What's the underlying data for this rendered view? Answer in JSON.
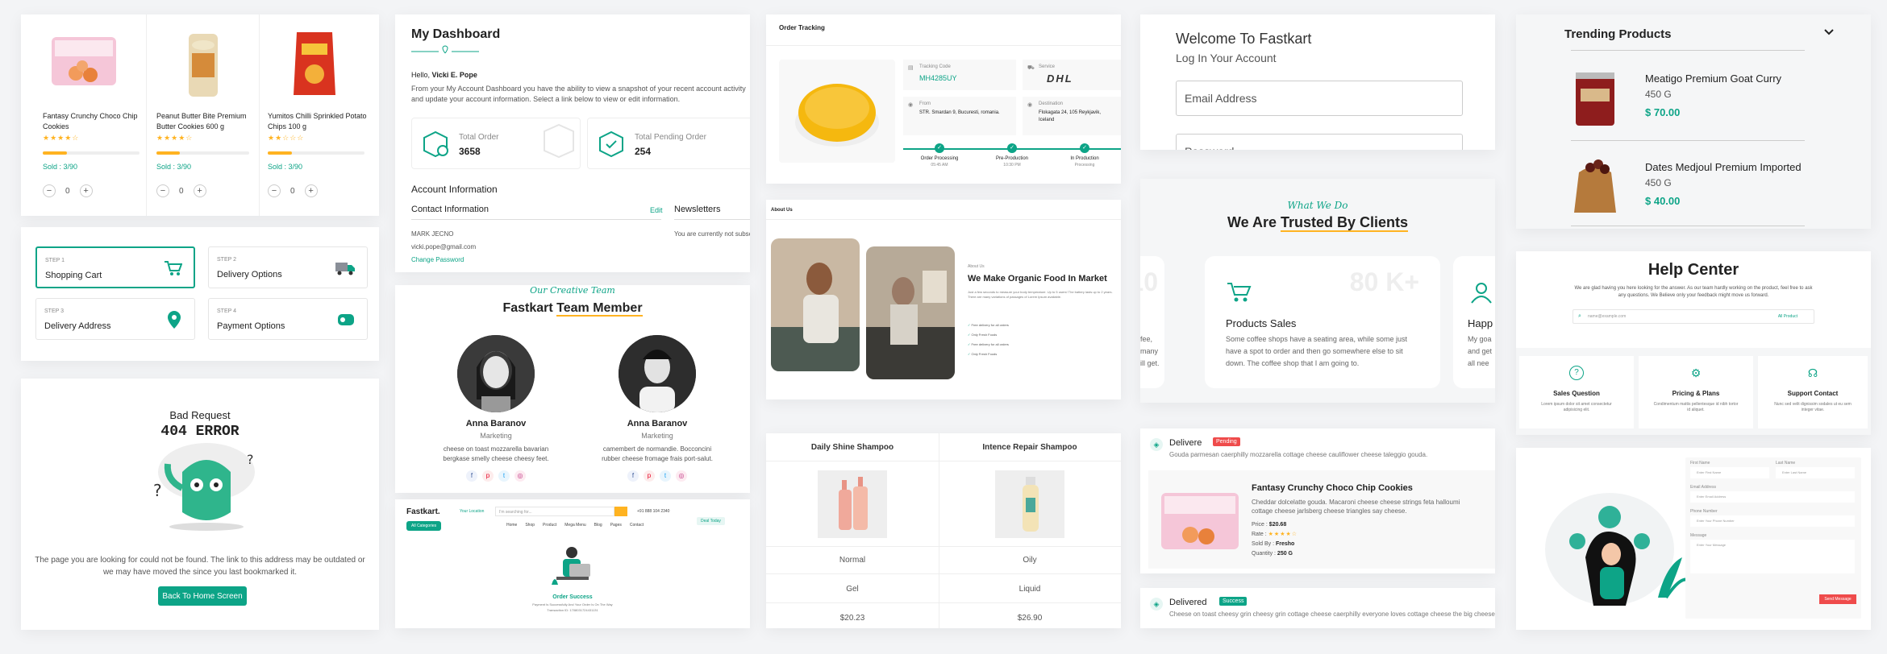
{
  "products": {
    "items": [
      {
        "name": "Fantasy Crunchy Choco Chip Cookies",
        "stars": "★★★★☆",
        "sold": "Sold : 3/90",
        "qty": "0",
        "fill": 0.25
      },
      {
        "name": "Peanut Butter Bite Premium Butter Cookies 600 g",
        "stars": "★★★★☆",
        "sold": "Sold : 3/90",
        "qty": "0",
        "fill": 0.25
      },
      {
        "name": "Yumitos Chilli Sprinkled Potato Chips 100 g",
        "stars": "★★☆☆☆",
        "sold": "Sold : 3/90",
        "qty": "0",
        "fill": 0.25
      }
    ],
    "minus": "−",
    "plus": "+"
  },
  "steps": [
    {
      "small": "STEP 1",
      "label": "Shopping Cart"
    },
    {
      "small": "STEP 2",
      "label": "Delivery Options"
    },
    {
      "small": "STEP 3",
      "label": "Delivery Address"
    },
    {
      "small": "STEP 4",
      "label": "Payment Options"
    }
  ],
  "error": {
    "bad": "Bad Request",
    "code": "404 ERROR",
    "message": "The page you are looking for could not be found. The link to this address may be outdated or we may have moved the since you last bookmarked it.",
    "button": "Back To Home Screen"
  },
  "dashboard": {
    "title": "My Dashboard",
    "hello": "Hello,",
    "user": "Vicki E. Pope",
    "intro": "From your My Account Dashboard you have the ability to view a snapshot of your recent account activity and update your account information. Select a link below to view or edit information.",
    "total_order_label": "Total Order",
    "total_order": "3658",
    "pending_label": "Total Pending Order",
    "pending": "254",
    "account_info": "Account Information",
    "contact_info": "Contact Information",
    "edit": "Edit",
    "newsletters": "Newsletters",
    "name": "MARK JECNO",
    "email": "vicki.pope@gmail.com",
    "change_password": "Change Password",
    "newsletter_text": "You are currently not subscribed to any newsletter."
  },
  "team": {
    "kicker": "Our Creative Team",
    "title_a": "Fastkart ",
    "title_b": "Team Member",
    "members": [
      {
        "name": "Anna Baranov",
        "role": "Marketing",
        "bio": "cheese on toast mozzarella bavarian bergkase smelly cheese cheesy feet."
      },
      {
        "name": "Anna Baranov",
        "role": "Marketing",
        "bio": "camembert de normandie. Bocconcini rubber cheese fromage frais port-salut."
      }
    ]
  },
  "store": {
    "logo": "Fastkart.",
    "location": "Your Location",
    "search": "I'm searching for...",
    "phone": "+91 888 104 2340",
    "deal": "Deal Today",
    "all_categories": "All Categories",
    "menu": [
      "Home",
      "Shop",
      "Product",
      "Mega Menu",
      "Blog",
      "Pages",
      "Contact"
    ],
    "success": "Order Success",
    "success_text": "Payment Is Successfully And Your Order Is On The Way",
    "txn": "Transaction ID: 1708031724431131"
  },
  "tracking": {
    "title": "Order Tracking",
    "code_label": "Tracking Code",
    "code": "MH4285UY",
    "service_label": "Service",
    "service": "DHL",
    "from_label": "From",
    "from": "STR. Smardan 9, Bucuresti, romania.",
    "dest_label": "Destination",
    "dest": "Flokagata 24, 105 Reykjavik, Iceland",
    "stages": [
      {
        "name": "Order Processing",
        "time": "05:45 AM"
      },
      {
        "name": "Pre-Production",
        "time": "10:30 PM"
      },
      {
        "name": "In Production",
        "time": "Processing"
      }
    ]
  },
  "about": {
    "section": "About Us",
    "kicker": "About Us",
    "title": "We Make Organic Food In Market",
    "text": "Just a few seconds to measure your body temperature. Up to 5 users! The battery lasts up to 2 years. There are many variations of passages of Lorem Ipsum available.",
    "list": [
      "Free delivery for all orders",
      "Only Fresh Foods",
      "Free delivery for all orders",
      "Only Fresh Foods"
    ]
  },
  "compare": {
    "cols": [
      "Daily Shine Shampoo",
      "Intence Repair Shampoo"
    ],
    "rows": [
      [
        "Normal",
        "Oily"
      ],
      [
        "Gel",
        "Liquid"
      ],
      [
        "$20.23",
        "$26.90"
      ]
    ]
  },
  "login": {
    "welcome": "Welcome To Fastkart",
    "sub": "Log In Your Account",
    "email_placeholder": "Email Address",
    "password_placeholder": "Password"
  },
  "trusted": {
    "kicker": "What We Do",
    "title_a": "We Are ",
    "title_b": "Trusted By Clients",
    "cards": [
      {
        "num": "10",
        "title": "",
        "text": "fee, many ill get."
      },
      {
        "num": "80 K+",
        "title": "Products Sales",
        "text": "Some coffee shops have a seating area, while some just have a spot to order and then go somewhere else to sit down. The coffee shop that I am going to."
      },
      {
        "num": "",
        "title": "Happ",
        "text": "My goa and get all nee"
      }
    ]
  },
  "orders": {
    "items": [
      {
        "status": "Delivere",
        "badge": "Pending",
        "text": "Gouda parmesan caerphilly mozzarella cottage cheese cauliflower cheese taleggio gouda."
      },
      {
        "status": "Delivered",
        "badge": "Success",
        "text": "Cheese on toast cheesy grin cheesy grin cottage cheese caerphilly everyone loves cottage cheese the big cheese."
      }
    ],
    "product": {
      "name": "Fantasy Crunchy Choco Chip Cookies",
      "desc": "Cheddar dolcelatte gouda. Macaroni cheese cheese strings feta halloumi cottage cheese jarlsberg cheese triangles say cheese.",
      "price_label": "Price :",
      "price": "$20.68",
      "rate_label": "Rate :",
      "sold_label": "Sold By :",
      "sold": "Fresho",
      "qty_label": "Quantity :",
      "qty": "250 G"
    }
  },
  "trending": {
    "title": "Trending Products",
    "items": [
      {
        "name": "Meatigo Premium Goat Curry",
        "weight": "450 G",
        "price": "$ 70.00"
      },
      {
        "name": "Dates Medjoul Premium Imported",
        "weight": "450 G",
        "price": "$ 40.00"
      }
    ]
  },
  "help": {
    "title": "Help Center",
    "text": "We are glad having you here looking for the answer. As our team hardly working on the product, feel free to ask any questions. We Believe only your feedback might move us forward.",
    "search_placeholder": "name@example.com",
    "product": "All Product",
    "cards": [
      {
        "title": "Sales Question",
        "text": "Lorem ipsum dolor sit amet consectetur adipisicing elit."
      },
      {
        "title": "Pricing & Plans",
        "text": "Condimentum mattis pellentesque id nibh tortor id aliquet."
      },
      {
        "title": "Support Contact",
        "text": "Nunc sed velit dignissim sodales ut eu sem integer vitae."
      }
    ]
  },
  "contact": {
    "first": "First Name",
    "last": "Last Name",
    "first_ph": "Enter First Name",
    "last_ph": "Enter Last Name",
    "email": "Email Address",
    "email_ph": "Enter Email Address",
    "phone": "Phone Number",
    "phone_ph": "Enter Your Phone Number",
    "message": "Message",
    "message_ph": "Enter Your Message",
    "send": "Send Message"
  }
}
